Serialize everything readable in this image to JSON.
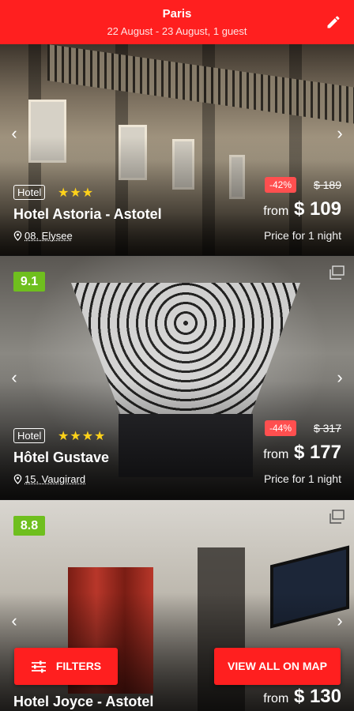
{
  "header": {
    "city": "Paris",
    "dates": "22 August - 23 August, 1 guest",
    "edit_icon": "pencil-icon",
    "color": "#ff1f1f"
  },
  "hotels": [
    {
      "type": "Hotel",
      "stars": 3,
      "stars_text": "★★★",
      "name": "Hotel Astoria - Astotel",
      "location": "08. Elysee",
      "discount": "-42%",
      "old_price": "$ 189",
      "from_label": "from",
      "price": "$ 109",
      "price_note": "Price for 1 night"
    },
    {
      "score": "9.1",
      "type": "Hotel",
      "stars": 4,
      "stars_text": "★★★★",
      "name": "Hôtel Gustave",
      "location": "15. Vaugirard",
      "discount": "-44%",
      "old_price": "$ 317",
      "from_label": "from",
      "price": "$ 177",
      "price_note": "Price for 1 night"
    },
    {
      "score": "8.8",
      "name": "Hotel Joyce - Astotel",
      "from_label": "from",
      "price": "$ 130"
    }
  ],
  "actions": {
    "filters_label": "FILTERS",
    "map_label": "VIEW ALL ON MAP"
  },
  "colors": {
    "accent": "#ff1f1f",
    "score_green": "#6fbf1e",
    "star_yellow": "#ffd21a",
    "discount_red": "#ff4f4f"
  }
}
